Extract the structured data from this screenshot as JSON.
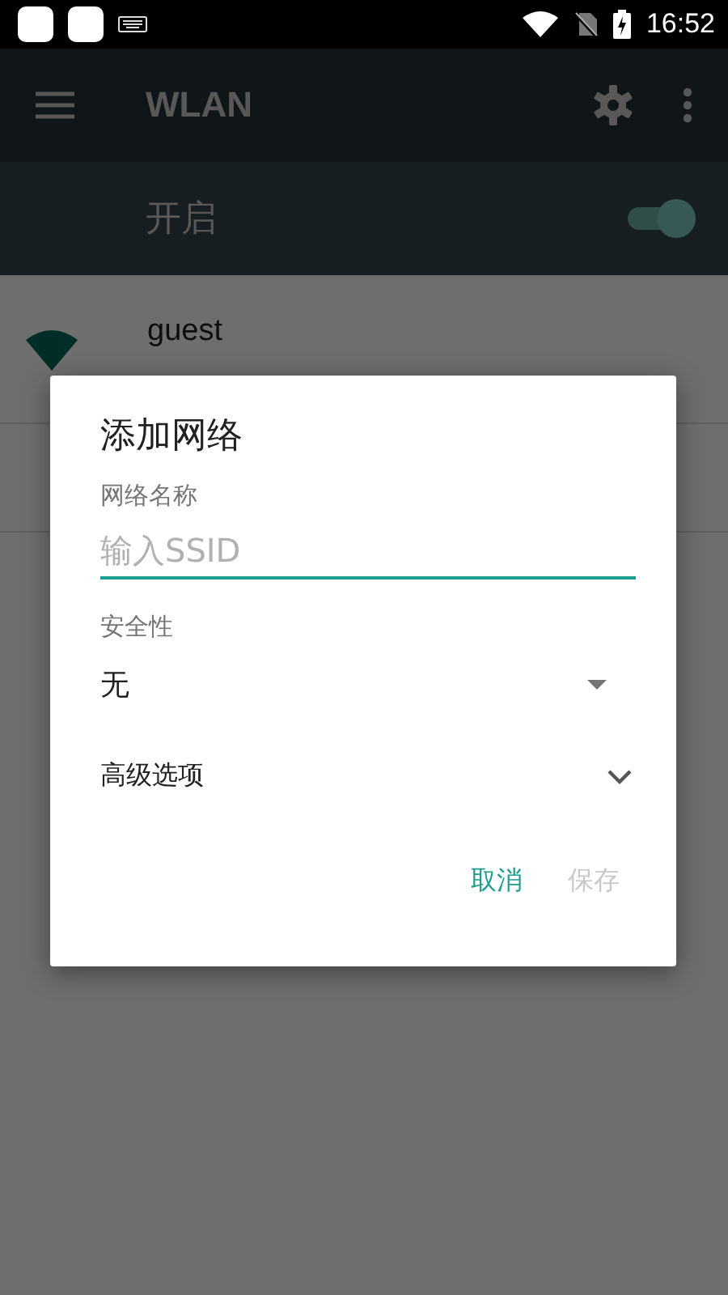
{
  "status_bar": {
    "time": "16:52"
  },
  "toolbar": {
    "title": "WLAN"
  },
  "master_switch": {
    "label": "开启",
    "on": true
  },
  "networks": [
    {
      "name": "guest"
    }
  ],
  "dialog": {
    "title": "添加网络",
    "ssid_field": {
      "label": "网络名称",
      "placeholder": "输入SSID"
    },
    "security": {
      "label": "安全性",
      "value": "无"
    },
    "advanced": {
      "label": "高级选项"
    },
    "buttons": [
      {
        "label": "取消",
        "disabled": false
      },
      {
        "label": "保存",
        "disabled": true
      }
    ]
  }
}
